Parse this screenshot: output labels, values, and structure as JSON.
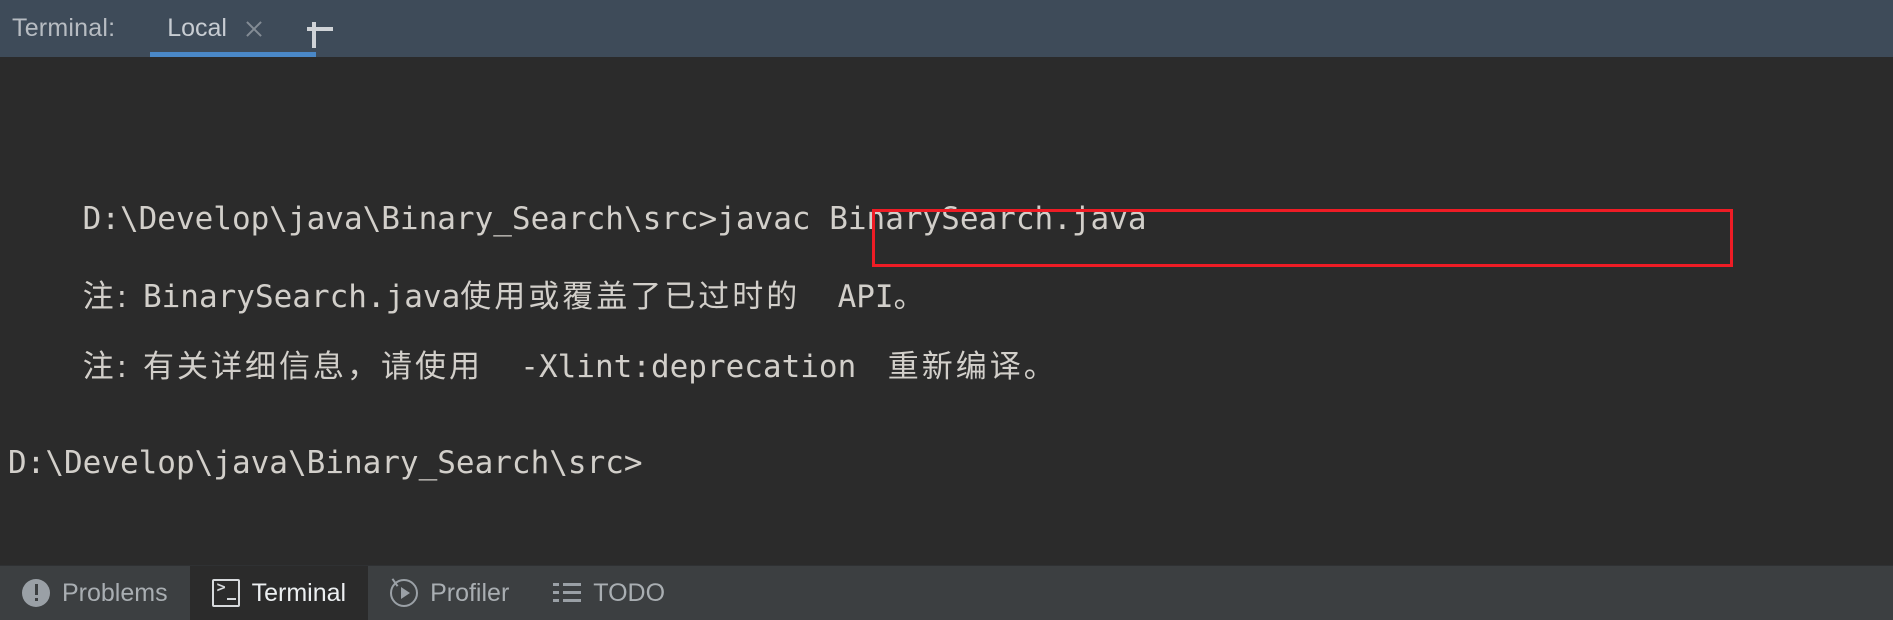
{
  "header": {
    "label": "Terminal:",
    "tab_label": "Local",
    "close_icon": "close-icon",
    "new_tab_icon": "plus-icon",
    "accent_color": "#4a88c7",
    "background_color": "#3e4b59"
  },
  "terminal": {
    "background_color": "#2b2b2b",
    "text_color": "#d2cfca",
    "lines": [
      "D:\\Develop\\java\\Binary_Search\\src>javac BinarySearch.java",
      "注: BinarySearch.java使用或覆盖了已过时的 API。",
      "注: 有关详细信息, 请使用 -Xlint:deprecation 重新编译。",
      "D:\\Develop\\java\\Binary_Search\\src>"
    ],
    "line1_prefix": "D:\\Develop\\java\\Binary_Search",
    "line1_highlighted": "\\src>javac BinarySearch.java",
    "line2_prefix": "注: ",
    "line2_mono": "BinarySearch.java",
    "line2_cjk": "使用或覆盖了已过时的",
    "line2_api": "  API。",
    "line3_prefix": "注: ",
    "line3_cjk_a": "有关详细信息，请使用",
    "line3_mono": "  -Xlint:deprecation ",
    "line3_cjk_b": " 重新编译。",
    "line4": "D:\\Develop\\java\\Binary_Search\\src>",
    "annotation_box_color": "#ee1c25"
  },
  "toolbar": {
    "background_color": "#3c3f41",
    "tabs": [
      {
        "label": "Problems",
        "icon": "problems-icon",
        "active": false
      },
      {
        "label": "Terminal",
        "icon": "terminal-icon",
        "active": true
      },
      {
        "label": "Profiler",
        "icon": "profiler-icon",
        "active": false
      },
      {
        "label": "TODO",
        "icon": "todo-icon",
        "active": false
      }
    ]
  }
}
